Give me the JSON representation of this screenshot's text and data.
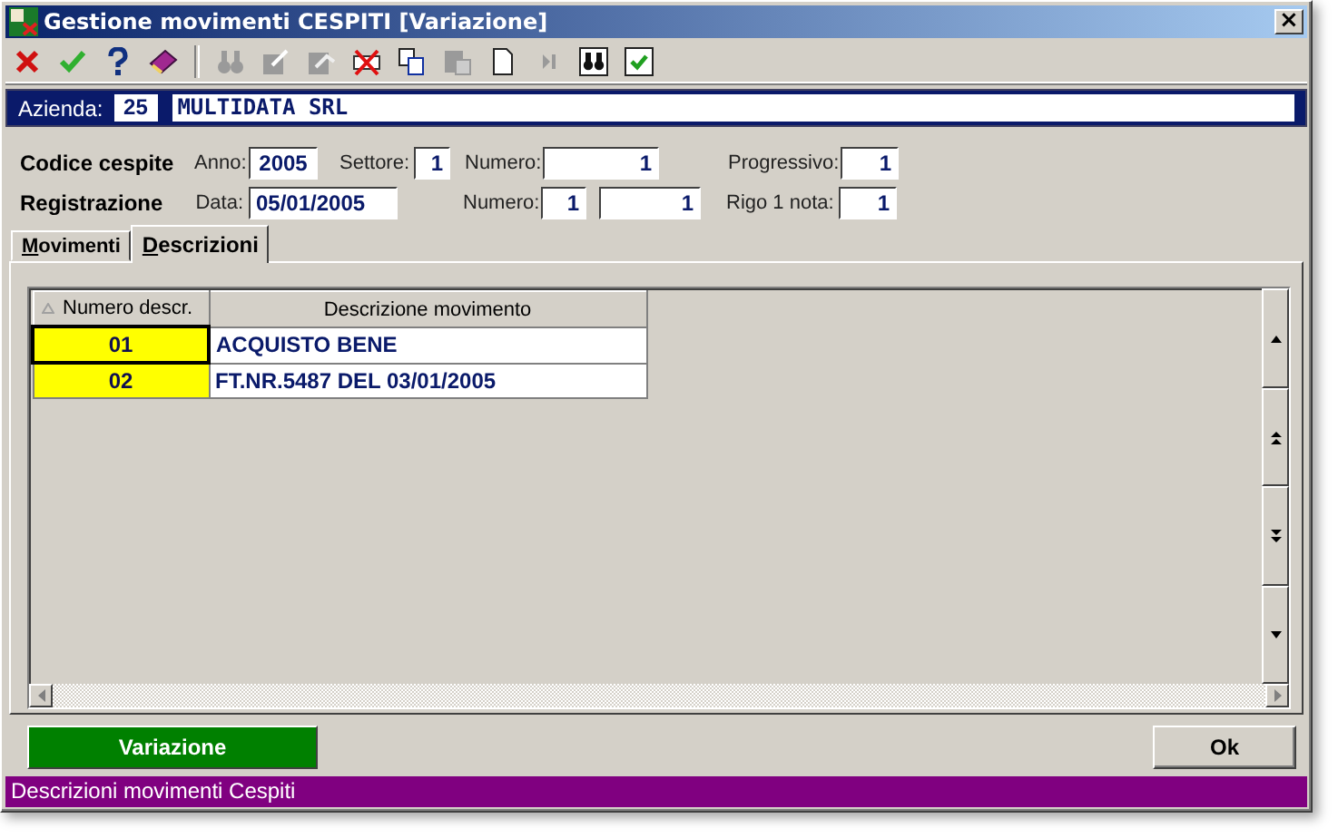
{
  "window": {
    "title": "Gestione movimenti CESPITI [Variazione]",
    "close": "×"
  },
  "toolbar": [
    {
      "kind": "cancel",
      "disabled": false
    },
    {
      "kind": "confirm",
      "disabled": false
    },
    {
      "kind": "help",
      "disabled": false
    },
    {
      "kind": "book",
      "disabled": false
    },
    {
      "kind": "binoculars",
      "disabled": true
    },
    {
      "kind": "edit",
      "disabled": true
    },
    {
      "kind": "edit2",
      "disabled": true
    },
    {
      "kind": "delete",
      "disabled": false
    },
    {
      "kind": "copy",
      "disabled": false
    },
    {
      "kind": "paste",
      "disabled": true
    },
    {
      "kind": "new",
      "disabled": false
    },
    {
      "kind": "last",
      "disabled": true
    },
    {
      "kind": "find",
      "disabled": false
    },
    {
      "kind": "check",
      "disabled": false
    }
  ],
  "company": {
    "label": "Azienda:",
    "code": "25",
    "name": "MULTIDATA SRL"
  },
  "form_rows": [
    {
      "label": "Codice cespite",
      "fields": [
        {
          "label": "Anno:",
          "value": "2005"
        },
        {
          "label": "Settore:",
          "value": "1"
        },
        {
          "label": "Numero:",
          "value": "1"
        },
        {
          "label": "Progressivo:",
          "value": "1"
        }
      ]
    },
    {
      "label": "Registrazione",
      "fields": [
        {
          "label": "Data:",
          "value": "05/01/2005"
        },
        {
          "label": "Numero:",
          "value": "1"
        },
        {
          "value": "1"
        },
        {
          "label": "Rigo 1 nota:",
          "value": "1"
        }
      ]
    }
  ],
  "tabs": [
    {
      "label": "Movimenti",
      "selected": false
    },
    {
      "label": "Descrizioni",
      "selected": true
    }
  ],
  "table": {
    "columns": [
      "Numero descr.",
      "Descrizione movimento"
    ],
    "rows": [
      {
        "number": "01",
        "description": "ACQUISTO BENE",
        "selected": true
      },
      {
        "number": "02",
        "description": "FT.NR.5487 DEL 03/01/2005",
        "selected": false
      }
    ]
  },
  "buttons": [
    {
      "label": "Variazione",
      "kind": "primary"
    },
    {
      "label": "Ok",
      "kind": "normal"
    }
  ],
  "status_bar": "Descrizioni movimenti Cespiti"
}
